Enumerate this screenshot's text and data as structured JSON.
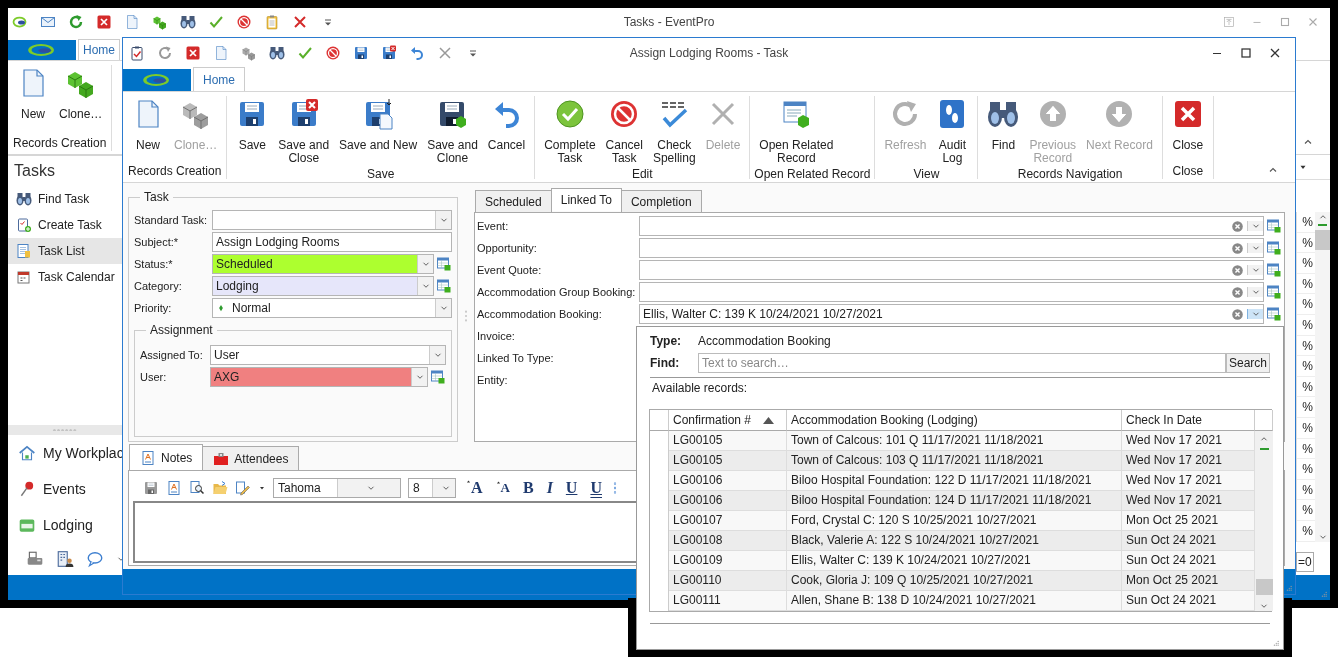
{
  "main_window": {
    "title": "Tasks - EventPro",
    "ribbon": {
      "tabs": [
        {
          "label": "Home",
          "selected": true
        }
      ],
      "groups": [
        {
          "label": "Records Creation",
          "buttons": [
            {
              "label": "New",
              "disabled": false
            },
            {
              "label": "Clone…",
              "disabled": false
            }
          ]
        }
      ]
    },
    "sidebar": {
      "title": "Tasks",
      "items": [
        {
          "label": "Find Task",
          "selected": false
        },
        {
          "label": "Create Task",
          "selected": false
        },
        {
          "label": "Task List",
          "selected": true
        },
        {
          "label": "Task Calendar",
          "selected": false
        }
      ],
      "nav": [
        {
          "label": "My Workplac"
        },
        {
          "label": "Events"
        },
        {
          "label": "Lodging"
        }
      ]
    },
    "percent_cells": [
      "%",
      "%",
      "%",
      "%",
      "%",
      "%",
      "%",
      "%",
      "%",
      "%",
      "%",
      "%",
      "%",
      "%",
      "%",
      "%"
    ],
    "filter_value": "=0"
  },
  "task_window": {
    "title": "Assign Lodging Rooms - Task",
    "ribbon": {
      "tabs": [
        {
          "label": "Home",
          "selected": true
        }
      ],
      "groups": [
        {
          "label": "Records Creation",
          "buttons": [
            {
              "label": "New",
              "disabled": false
            },
            {
              "label": "Clone…",
              "disabled": true
            }
          ]
        },
        {
          "label": "Save",
          "buttons": [
            {
              "label": "Save",
              "disabled": false
            },
            {
              "label": "Save and\nClose",
              "disabled": false
            },
            {
              "label": "Save and New",
              "disabled": false
            },
            {
              "label": "Save and\nClone",
              "disabled": false
            },
            {
              "label": "Cancel",
              "disabled": false
            }
          ]
        },
        {
          "label": "Edit",
          "buttons": [
            {
              "label": "Complete\nTask",
              "disabled": false
            },
            {
              "label": "Cancel\nTask",
              "disabled": false
            },
            {
              "label": "Check\nSpelling",
              "disabled": false
            },
            {
              "label": "Delete",
              "disabled": true
            }
          ]
        },
        {
          "label": "Open Related Record",
          "buttons": [
            {
              "label": "Open Related\nRecord",
              "disabled": false
            }
          ]
        },
        {
          "label": "View",
          "buttons": [
            {
              "label": "Refresh",
              "disabled": true
            },
            {
              "label": "Audit\nLog",
              "disabled": false
            }
          ]
        },
        {
          "label": "Records Navigation",
          "buttons": [
            {
              "label": "Find",
              "disabled": false
            },
            {
              "label": "Previous\nRecord",
              "disabled": true
            },
            {
              "label": "Next Record",
              "disabled": true
            }
          ]
        },
        {
          "label": "Close",
          "buttons": [
            {
              "label": "Close",
              "disabled": false
            }
          ]
        }
      ]
    },
    "task_group": {
      "title": "Task",
      "fields": [
        {
          "label": "Standard Task:",
          "kind": "combo"
        },
        {
          "label": "Subject:*",
          "kind": "text",
          "value": "Assign Lodging Rooms"
        },
        {
          "label": "Status:*",
          "kind": "lookup",
          "value": "Scheduled",
          "color": "#adff2f"
        },
        {
          "label": "Category:",
          "kind": "lookup",
          "value": "Lodging",
          "color": "#e6e6fa"
        },
        {
          "label": "Priority:",
          "kind": "priority",
          "value": "Normal"
        }
      ]
    },
    "assignment_group": {
      "title": "Assignment",
      "fields": [
        {
          "label": "Assigned To:",
          "kind": "combo",
          "value": "User"
        },
        {
          "label": "User:",
          "kind": "lookup",
          "value": "AXG",
          "color": "#f08080"
        }
      ]
    },
    "tabs": [
      {
        "label": "Scheduled",
        "selected": false
      },
      {
        "label": "Linked To",
        "selected": true
      },
      {
        "label": "Completion",
        "selected": false
      }
    ],
    "linked_fields": [
      {
        "label": "Event:",
        "kind": "picker",
        "expanded": false
      },
      {
        "label": "Opportunity:",
        "kind": "picker",
        "expanded": false
      },
      {
        "label": "Event Quote:",
        "kind": "picker",
        "expanded": false
      },
      {
        "label": "Accommodation Group Booking:",
        "kind": "picker",
        "expanded": false
      },
      {
        "label": "Accommodation Booking:",
        "kind": "picker",
        "value": "Ellis, Walter C: 139 K 10/24/2021 10/27/2021",
        "expanded": true
      },
      {
        "label": "Invoice:",
        "kind": "label"
      },
      {
        "label": "Linked To Type:",
        "kind": "label"
      },
      {
        "label": "Entity:",
        "kind": "label"
      }
    ],
    "bottom_tabs": [
      {
        "label": "Notes",
        "selected": true
      },
      {
        "label": "Attendees",
        "selected": false
      }
    ],
    "notes_toolbar": {
      "font": "Tahoma",
      "size": "8",
      "format_buttons": [
        {
          "glyph": "A",
          "kind": "grow"
        },
        {
          "glyph": "A",
          "kind": "shrink"
        },
        {
          "glyph": "B",
          "kind": "bold"
        },
        {
          "glyph": "I",
          "kind": "italic"
        },
        {
          "glyph": "U",
          "kind": "underline"
        },
        {
          "glyph": "U",
          "kind": "double-underline"
        }
      ]
    }
  },
  "lookup_popup": {
    "type_label": "Type:",
    "type_value": "Accommodation Booking",
    "find_label": "Find:",
    "search_placeholder": "Text to search…",
    "search_button": "Search",
    "records_label": "Available records:",
    "grid": {
      "columns": [
        {
          "label": "Confirmation #",
          "sorted": true
        },
        {
          "label": "Accommodation Booking (Lodging)",
          "sorted": false
        },
        {
          "label": "Check In Date",
          "sorted": false
        }
      ],
      "rows": [
        [
          "LG00105",
          "Town of Calcous: 101 Q 11/17/2021 11/18/2021",
          "Wed Nov 17 2021"
        ],
        [
          "LG00105",
          "Town of Calcous: 103 Q 11/17/2021 11/18/2021",
          "Wed Nov 17 2021"
        ],
        [
          "LG00106",
          "Biloo Hospital Foundation: 122 D 11/17/2021 11/18/2021",
          "Wed Nov 17 2021"
        ],
        [
          "LG00106",
          "Biloo Hospital Foundation: 124 D 11/17/2021 11/18/2021",
          "Wed Nov 17 2021"
        ],
        [
          "LG00107",
          "Ford, Crystal C: 120 S 10/25/2021 10/27/2021",
          "Mon Oct 25 2021"
        ],
        [
          "LG00108",
          "Black, Valerie A: 122 S 10/24/2021 10/27/2021",
          "Sun Oct 24 2021"
        ],
        [
          "LG00109",
          "Ellis, Walter C: 139 K 10/24/2021 10/27/2021",
          "Sun Oct 24 2021"
        ],
        [
          "LG00110",
          "Cook, Gloria J: 109 Q 10/25/2021 10/27/2021",
          "Mon Oct 25 2021"
        ],
        [
          "LG00111",
          "Allen, Shane B: 138 D 10/24/2021 10/27/2021",
          "Sun Oct 24 2021"
        ]
      ]
    }
  }
}
